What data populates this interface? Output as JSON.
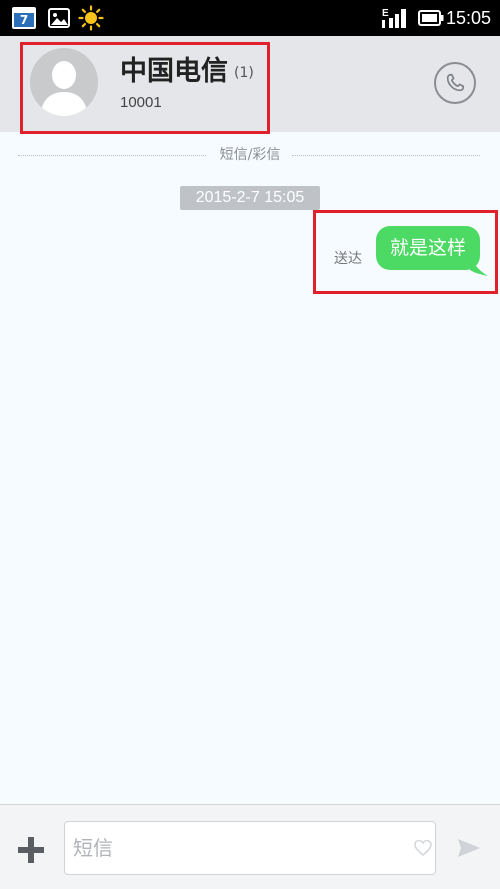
{
  "status_bar": {
    "calendar_day": "7",
    "time": "15:05",
    "signal_label": "E"
  },
  "header": {
    "contact_name": "中国电信",
    "message_count": "(1)",
    "contact_number": "10001"
  },
  "thread": {
    "channel_label": "短信/彩信",
    "timestamp": "2015-2-7 15:05",
    "messages": [
      {
        "text": "就是这样",
        "status": "送达",
        "direction": "outgoing"
      }
    ]
  },
  "composer": {
    "placeholder": "短信"
  },
  "colors": {
    "bubble": "#4cd964",
    "header_bg": "#e4e6e9",
    "highlight": "#e0212b",
    "status_bar_bg": "#000000"
  },
  "icons": {
    "calendar": "calendar-icon",
    "gallery": "gallery-icon",
    "weather": "sun-icon",
    "signal": "signal-icon",
    "battery": "battery-icon",
    "avatar": "avatar-icon",
    "call": "phone-icon",
    "add": "plus-icon",
    "emoji": "heart-icon",
    "send": "send-icon"
  }
}
